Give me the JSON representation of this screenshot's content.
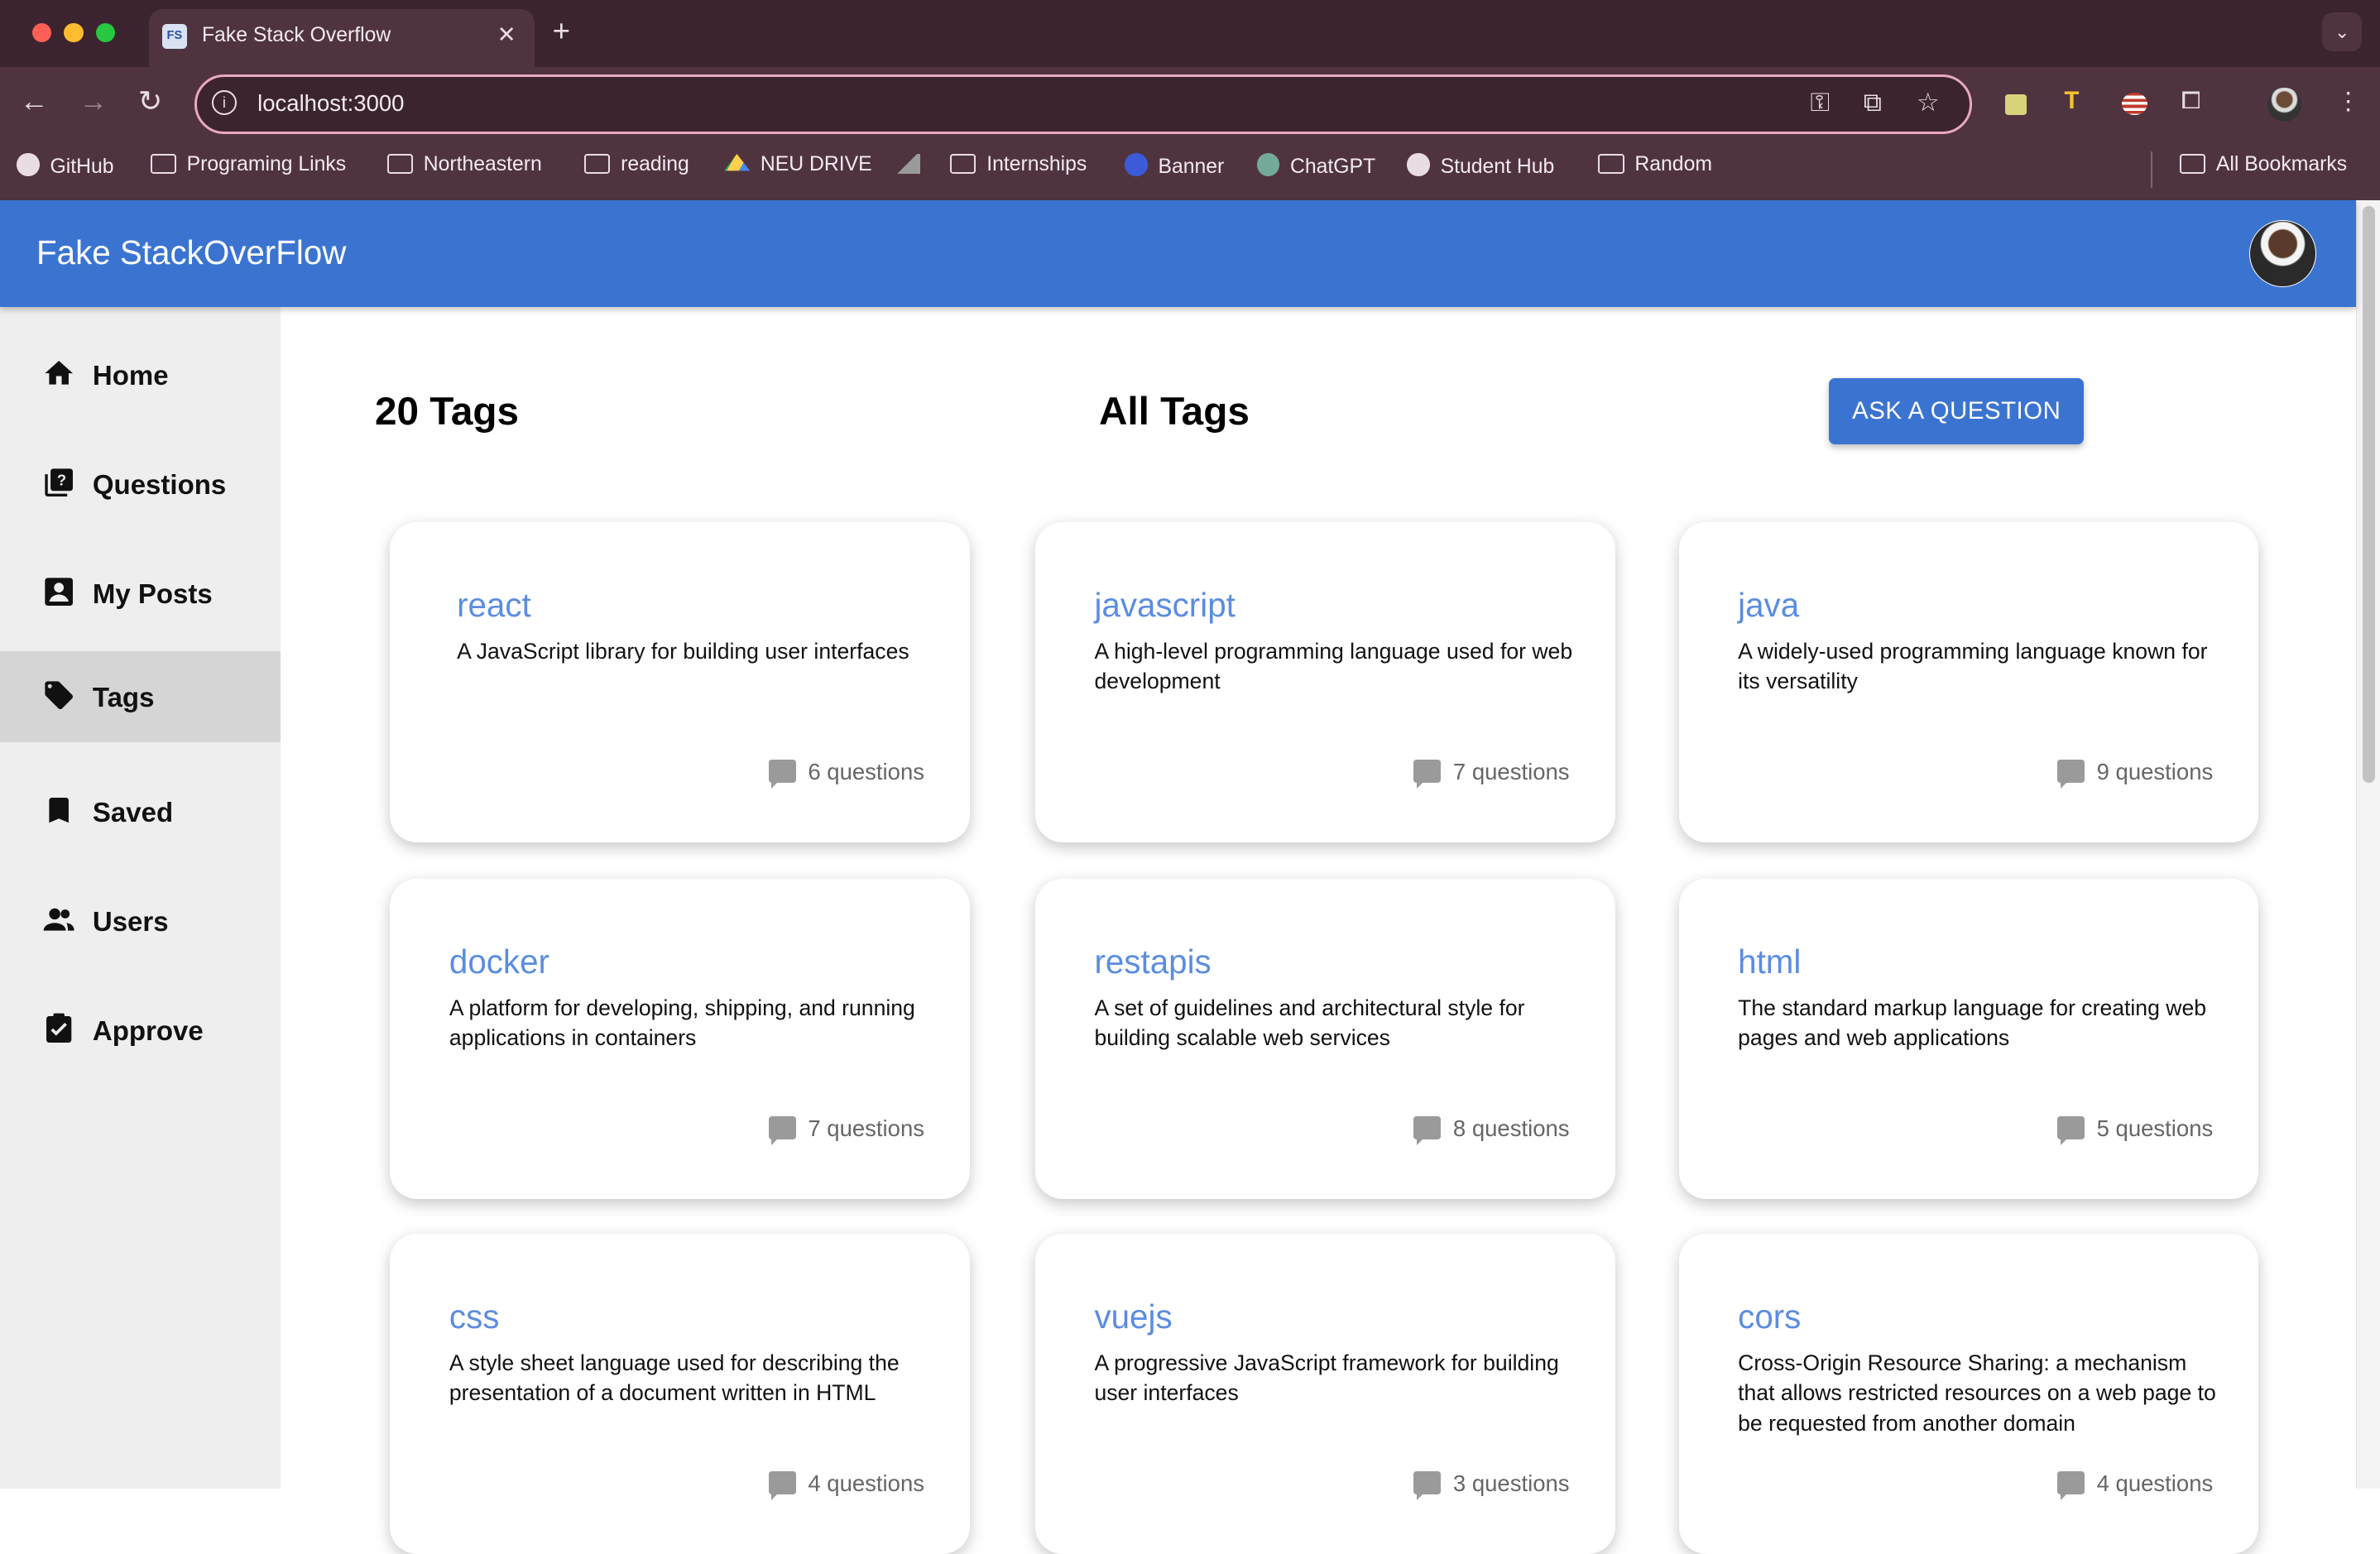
{
  "browser": {
    "tab_title": "Fake Stack Overflow",
    "tab_favicon_text": "FS",
    "url": "localhost:3000",
    "bookmarks": [
      {
        "label": "GitHub",
        "icon": "github-icon"
      },
      {
        "label": "Programing Links",
        "icon": "folder-icon"
      },
      {
        "label": "Northeastern",
        "icon": "folder-icon"
      },
      {
        "label": "reading",
        "icon": "folder-icon"
      },
      {
        "label": "NEU DRIVE",
        "icon": "drive-icon"
      },
      {
        "label": "",
        "icon": "chart-icon"
      },
      {
        "label": "Internships",
        "icon": "folder-icon"
      },
      {
        "label": "Banner",
        "icon": "banner-icon"
      },
      {
        "label": "ChatGPT",
        "icon": "chatgpt-icon"
      },
      {
        "label": "Student Hub",
        "icon": "globe-icon"
      },
      {
        "label": "Random",
        "icon": "folder-icon"
      }
    ],
    "all_bookmarks": "All Bookmarks"
  },
  "app": {
    "title": "Fake StackOverFlow",
    "accent_color": "#3b74d0"
  },
  "sidebar": {
    "items": [
      {
        "label": "Home",
        "icon": "home-icon",
        "active": false
      },
      {
        "label": "Questions",
        "icon": "questions-icon",
        "active": false
      },
      {
        "label": "My Posts",
        "icon": "account-box-icon",
        "active": false
      },
      {
        "label": "Tags",
        "icon": "tag-icon",
        "active": true
      },
      {
        "label": "Saved",
        "icon": "bookmark-icon",
        "active": false
      },
      {
        "label": "Users",
        "icon": "users-icon",
        "active": false
      },
      {
        "label": "Approve",
        "icon": "approve-icon",
        "active": false
      }
    ]
  },
  "main": {
    "tag_count": "20 Tags",
    "title": "All Tags",
    "ask_button": "ASK A QUESTION",
    "tags": [
      {
        "name": "react",
        "description": "A JavaScript library for building user interfaces",
        "count": "6 questions"
      },
      {
        "name": "javascript",
        "description": "A high-level programming language used for web development",
        "count": "7 questions"
      },
      {
        "name": "java",
        "description": "A widely-used programming language known for its versatility",
        "count": "9 questions"
      },
      {
        "name": "docker",
        "description": "A platform for developing, shipping, and running applications in containers",
        "count": "7 questions"
      },
      {
        "name": "restapis",
        "description": "A set of guidelines and architectural style for building scalable web services",
        "count": "8 questions"
      },
      {
        "name": "html",
        "description": "The standard markup language for creating web pages and web applications",
        "count": "5 questions"
      },
      {
        "name": "css",
        "description": "A style sheet language used for describing the presentation of a document written in HTML",
        "count": "4 questions"
      },
      {
        "name": "vuejs",
        "description": "A progressive JavaScript framework for building user interfaces",
        "count": "3 questions"
      },
      {
        "name": "cors",
        "description": "Cross-Origin Resource Sharing: a mechanism that allows restricted resources on a web page to be requested from another domain",
        "count": "4 questions"
      }
    ]
  }
}
